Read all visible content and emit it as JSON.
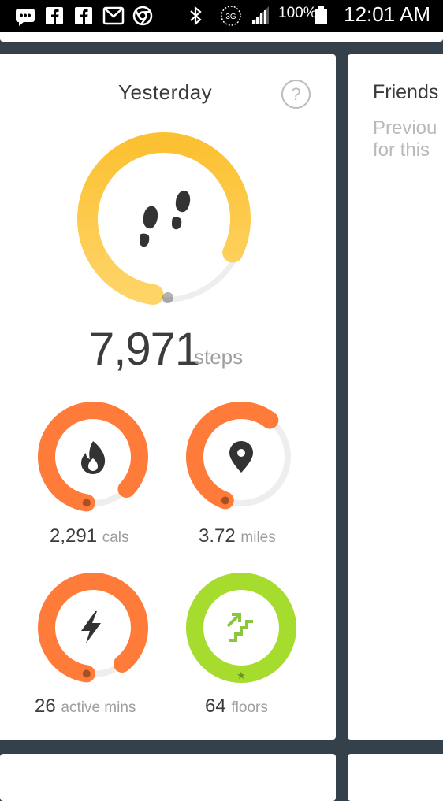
{
  "status_bar": {
    "battery": "100%",
    "network": "3G",
    "time": "12:01 AM",
    "icons": [
      "messages-icon",
      "facebook-icon",
      "facebook-icon",
      "gmail-icon",
      "chrome-icon",
      "bluetooth-icon",
      "signal-icon",
      "battery-icon"
    ]
  },
  "main_card": {
    "title": "Yesterday",
    "help_symbol": "?",
    "steps": {
      "value": "7,971",
      "unit": "steps",
      "progress": 0.8,
      "color": "#fcc63a"
    },
    "stats": [
      {
        "name": "calories",
        "value": "2,291",
        "unit": "cals",
        "progress": 0.85,
        "color": "#fe7b3a",
        "icon": "flame-icon"
      },
      {
        "name": "distance",
        "value": "3.72",
        "unit": "miles",
        "progress": 0.55,
        "color": "#fe7b3a",
        "icon": "location-pin-icon"
      },
      {
        "name": "active-minutes",
        "value": "26",
        "unit": "active mins",
        "progress": 0.87,
        "color": "#fe7b3a",
        "icon": "lightning-bolt-icon"
      },
      {
        "name": "floors",
        "value": "64",
        "unit": "floors",
        "progress": 1.0,
        "color": "#a6dc2d",
        "icon": "stairs-icon"
      }
    ]
  },
  "friends_card": {
    "title": "Friends",
    "description": "Previou\nfor this"
  }
}
